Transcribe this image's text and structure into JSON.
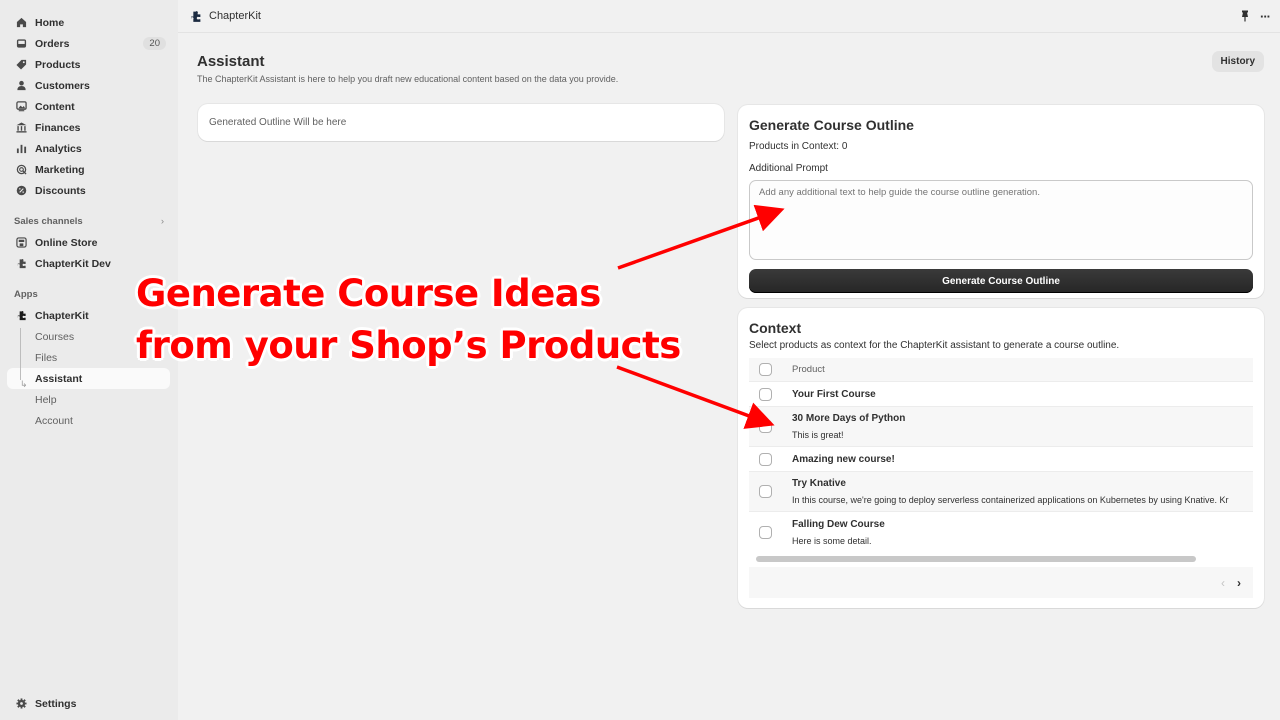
{
  "sidebar": {
    "main_items": [
      {
        "label": "Home",
        "icon": "home-icon"
      },
      {
        "label": "Orders",
        "icon": "inbox-icon",
        "badge": "20"
      },
      {
        "label": "Products",
        "icon": "tag-icon"
      },
      {
        "label": "Customers",
        "icon": "person-icon"
      },
      {
        "label": "Content",
        "icon": "image-icon"
      },
      {
        "label": "Finances",
        "icon": "bank-icon"
      },
      {
        "label": "Analytics",
        "icon": "bar-chart-icon"
      },
      {
        "label": "Marketing",
        "icon": "target-icon"
      },
      {
        "label": "Discounts",
        "icon": "discount-icon"
      }
    ],
    "sales_channels_label": "Sales channels",
    "sales_channels": [
      {
        "label": "Online Store",
        "icon": "store-icon"
      },
      {
        "label": "ChapterKit Dev",
        "icon": "puzzle-icon"
      }
    ],
    "apps_label": "Apps",
    "app": {
      "label": "ChapterKit",
      "icon": "puzzle-icon"
    },
    "app_subitems": [
      "Courses",
      "Files",
      "Assistant",
      "Help",
      "Account"
    ],
    "active_subitem": "Assistant",
    "settings_label": "Settings"
  },
  "topbar": {
    "app_name": "ChapterKit",
    "pin_icon": "pin-icon",
    "more_icon": "more-horizontal-icon"
  },
  "page": {
    "title": "Assistant",
    "subtitle": "The ChapterKit Assistant is here to help you draft new educational content based on the data you provide.",
    "history_label": "History"
  },
  "outline": {
    "placeholder_text": "Generated Outline Will be here"
  },
  "generate": {
    "title": "Generate Course Outline",
    "products_in_context": "Products in Context: 0",
    "prompt_label": "Additional Prompt",
    "prompt_placeholder": "Add any additional text to help guide the course outline generation.",
    "prompt_value": "",
    "button_label": "Generate Course Outline"
  },
  "context": {
    "title": "Context",
    "description": "Select products as context for the ChapterKit assistant to generate a course outline.",
    "column_header": "Product",
    "rows": [
      {
        "name": "Your First Course",
        "detail": ""
      },
      {
        "name": "30 More Days of Python",
        "detail": "This is great!"
      },
      {
        "name": "Amazing new course!",
        "detail": ""
      },
      {
        "name": "Try Knative",
        "detail": "In this course, we're going to deploy serverless containerized applications on Kubernetes by using Knative. Kr"
      },
      {
        "name": "Falling Dew Course",
        "detail": "Here is some detail."
      }
    ],
    "pager_prev": "‹",
    "pager_next": "›"
  },
  "overlay": {
    "headline_line1": "Generate Course Ideas",
    "headline_line2": "from your Shop’s Products",
    "arrow_color": "#ff0000"
  }
}
